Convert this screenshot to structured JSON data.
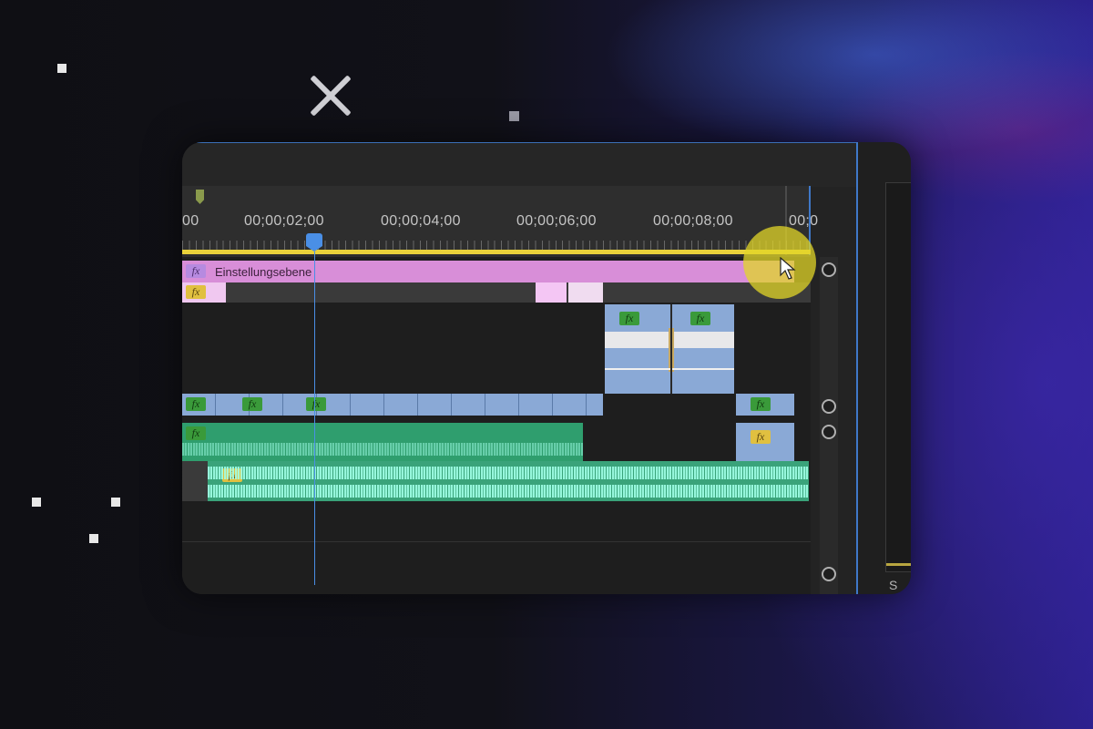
{
  "timeline": {
    "timecodes": [
      "00",
      "00;00;02;00",
      "00;00;04;00",
      "00;00;06;00",
      "00;00;08;00",
      "00;0"
    ],
    "adjustment_layer_label": "Einstellungsebene",
    "fx_label": "fx"
  },
  "panel": {
    "side_letter": "S"
  },
  "colors": {
    "work_area": "#e9d23a",
    "playhead": "#4a8fe6",
    "adjustment_clip": "#d88ed8",
    "video_clip": "#8aa9d6",
    "audio_clip": "#2f9e6e",
    "fx_badge_green": "#3a9a3a",
    "fx_badge_yellow": "#e0c040"
  }
}
